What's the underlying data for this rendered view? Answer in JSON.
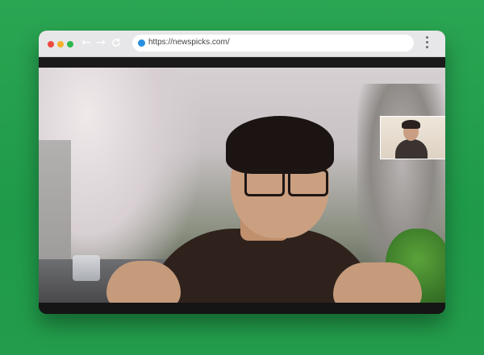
{
  "browser": {
    "address_bar": {
      "url": "https://newspicks.com/"
    },
    "icons": {
      "back": "arrow-left-icon",
      "forward": "arrow-right-icon",
      "reload": "reload-icon",
      "site": "globe-icon",
      "bookmark": "star-icon",
      "menu": "kebab-menu-icon"
    },
    "colors": {
      "background": "#25a04e",
      "toolbar": "#e7e7e9",
      "close": "#ec4a3f",
      "minimize": "#f3b12b",
      "maximize": "#2fb84d",
      "bookmark_star": "#f6c915"
    }
  },
  "video_call": {
    "main_feed": "video-feed",
    "self_view": "picture-in-picture"
  }
}
